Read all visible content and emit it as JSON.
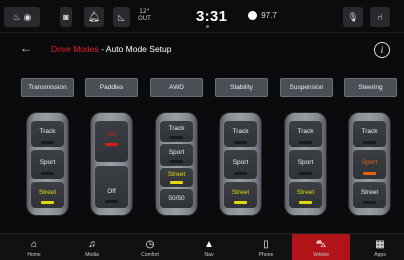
{
  "status_bar": {
    "temp_label": "12°",
    "temp_label2": "OUT",
    "clock": "3:31",
    "radio": "97.7"
  },
  "header": {
    "back": "←",
    "title_highlight": "Drive Modes",
    "title_rest": " - Auto Mode Setup",
    "info": "i"
  },
  "categories": [
    "Transmission",
    "Paddles",
    "AWD",
    "Stability",
    "Suspension",
    "Steering"
  ],
  "selectors": [
    {
      "slots": [
        "Track",
        "Sport",
        "Street"
      ],
      "selected": "Street"
    },
    {
      "slots": [
        "On",
        "Off"
      ],
      "selected": "On"
    },
    {
      "slots": [
        "Track",
        "Sport",
        "Street",
        "50/50"
      ],
      "selected": "Street"
    },
    {
      "slots": [
        "Track",
        "Sport",
        "Street"
      ],
      "selected": "Street"
    },
    {
      "slots": [
        "Track",
        "Sport",
        "Street"
      ],
      "selected": "Street"
    },
    {
      "slots": [
        "Track",
        "Sport",
        "Street"
      ],
      "selected": "Sport"
    }
  ],
  "nav": [
    "Home",
    "Media",
    "Comfort",
    "Nav",
    "Phone",
    "Vehicle",
    "Apps"
  ],
  "nav_active": "Vehicle",
  "colors": {
    "accent_red": "#e0202a",
    "selected_yellow": "#e5d90c",
    "sport_orange": "#e8620e",
    "nav_active": "#b01418"
  }
}
